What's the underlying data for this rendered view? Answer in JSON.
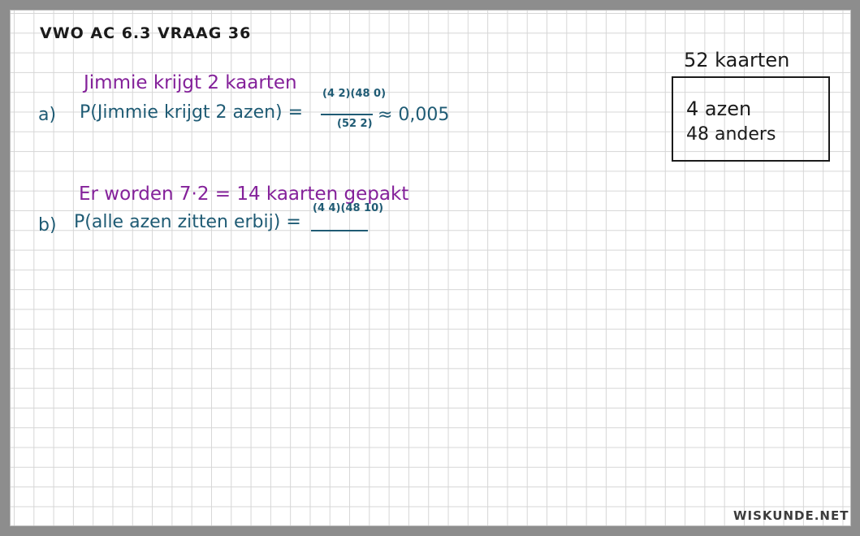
{
  "header": {
    "title": "VWO AC 6.3 VRAAG 36"
  },
  "info_box": {
    "title": "52 kaarten",
    "line1": "4 azen",
    "line2": "48 anders"
  },
  "part_a": {
    "label": "a)",
    "note": "Jimmie krijgt 2 kaarten",
    "expression": "P(Jimmie krijgt 2 azen) =",
    "numerator": "(4 2)(48 0)",
    "denominator": "(52 2)",
    "result": "≈ 0,005"
  },
  "part_b": {
    "label": "b)",
    "note": "Er worden 7·2 = 14 kaarten gepakt",
    "expression": "P(alle azen zitten erbij) =",
    "numerator": "(4 4)(48 10)"
  },
  "brand": "WISKUNDE.NET",
  "colors": {
    "black_ink": "#1b1b1b",
    "blue_ink": "#1f5b74",
    "purple_ink": "#84219a",
    "grid": "#d6d6d6",
    "frame": "#8d8d8d"
  }
}
